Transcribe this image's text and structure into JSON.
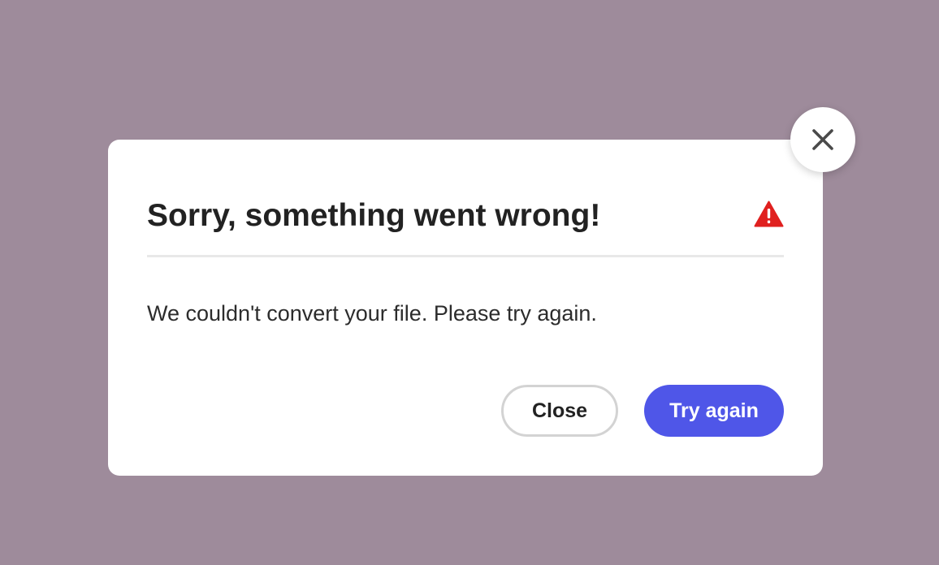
{
  "colors": {
    "backdrop": "#9e8b9b",
    "primary_button": "#4f56e8",
    "warning": "#e0201f"
  },
  "dialog": {
    "title": "Sorry, something went wrong!",
    "message": "We couldn't convert your file. Please try again.",
    "status_icon": "warning-triangle-icon",
    "dismiss_icon": "close-x-icon",
    "buttons": {
      "close_label": "Close",
      "retry_label": "Try again"
    }
  }
}
